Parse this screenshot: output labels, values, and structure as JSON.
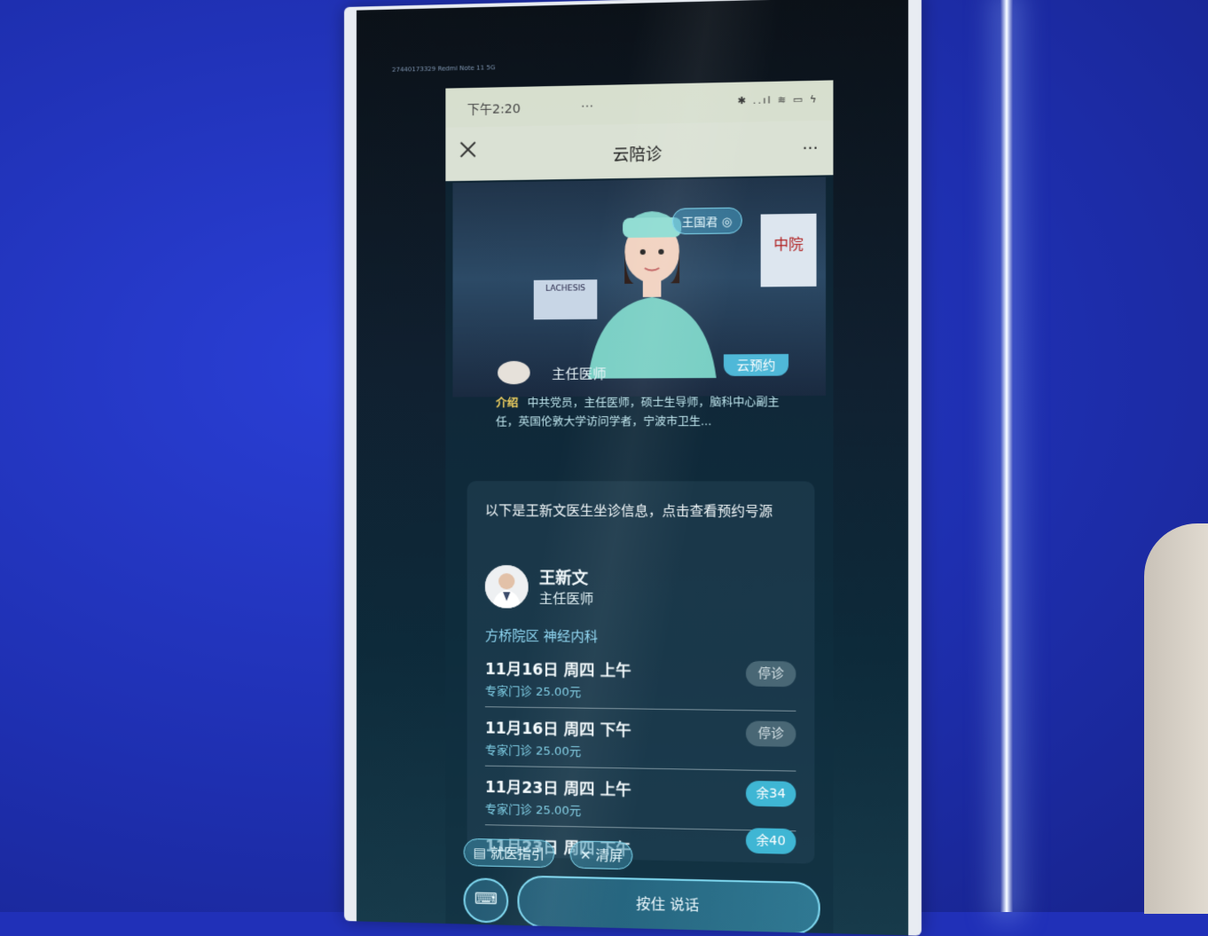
{
  "device_tag": "27440173329 Redmi Note 11 5G",
  "statusbar": {
    "time": "下午2:20",
    "dots": "…",
    "icons": "✱ ..ıl ≋ ▭ ϟ"
  },
  "navbar": {
    "title": "云陪诊",
    "more": "···"
  },
  "video": {
    "user_pill": "王国君",
    "sign_left": "LACHESIS",
    "sign_right": "中院"
  },
  "doctor_top": {
    "title": "主任医师",
    "book_label": "云预约",
    "intro_tag": "介绍",
    "intro_text": "中共党员，主任医师，硕士生导师，脑科中心副主任，英国伦敦大学访问学者，宁波市卫生..."
  },
  "chat": {
    "message": "以下是王新文医生坐诊信息，点击查看预约号源",
    "doctor_name": "王新文",
    "doctor_rank": "主任医师",
    "department": "方桥院区 神经内科",
    "slots": [
      {
        "date": "11月16日 周四 上午",
        "info": "专家门诊  25.00元",
        "status": "停诊"
      },
      {
        "date": "11月16日 周四 下午",
        "info": "专家门诊  25.00元",
        "status": "停诊"
      },
      {
        "date": "11月23日 周四 上午",
        "info": "专家门诊  25.00元",
        "status": "余34"
      },
      {
        "date": "11月23日 周四 下午",
        "info": "",
        "status": "余40"
      }
    ]
  },
  "bottom": {
    "guide_label": "就医指引",
    "clear_label": "清屏",
    "talk_label": "按住 说话",
    "keyboard_icon": "keyboard-icon"
  }
}
